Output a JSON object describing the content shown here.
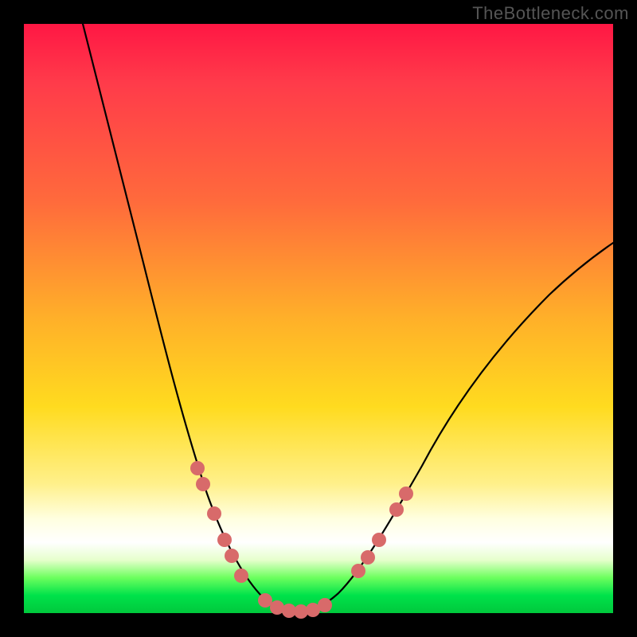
{
  "watermark": "TheBottleneck.com",
  "colors": {
    "gradient_top": "#ff1744",
    "gradient_mid": "#ffdb1f",
    "gradient_green": "#00e24a",
    "frame": "#000000",
    "curve": "#000000",
    "dots": "#d86a6a"
  },
  "chart_data": {
    "type": "line",
    "title": "",
    "xlabel": "",
    "ylabel": "",
    "ylim": [
      0,
      100
    ],
    "xlim": [
      0,
      100
    ],
    "x": [
      10,
      15,
      20,
      25,
      27,
      29,
      31,
      33,
      35,
      38,
      40,
      42,
      44,
      46,
      48,
      50,
      52,
      55,
      58,
      62,
      68,
      75,
      85,
      95,
      100
    ],
    "series": [
      {
        "name": "bottleneck-curve",
        "values": [
          100,
          82,
          64,
          46,
          39,
          32,
          26,
          20,
          14,
          8,
          5,
          3,
          2,
          1,
          1,
          2,
          4,
          7,
          12,
          18,
          26,
          35,
          46,
          56,
          61
        ]
      }
    ],
    "markers": [
      {
        "x": 29,
        "y": 32
      },
      {
        "x": 30,
        "y": 29
      },
      {
        "x": 32,
        "y": 22
      },
      {
        "x": 34,
        "y": 16
      },
      {
        "x": 35,
        "y": 13
      },
      {
        "x": 37,
        "y": 9
      },
      {
        "x": 42,
        "y": 3
      },
      {
        "x": 44,
        "y": 2
      },
      {
        "x": 46,
        "y": 1
      },
      {
        "x": 48,
        "y": 1
      },
      {
        "x": 50,
        "y": 2
      },
      {
        "x": 52,
        "y": 4
      },
      {
        "x": 58,
        "y": 12
      },
      {
        "x": 60,
        "y": 15
      },
      {
        "x": 62,
        "y": 18
      },
      {
        "x": 66,
        "y": 24
      },
      {
        "x": 68,
        "y": 27
      }
    ]
  }
}
